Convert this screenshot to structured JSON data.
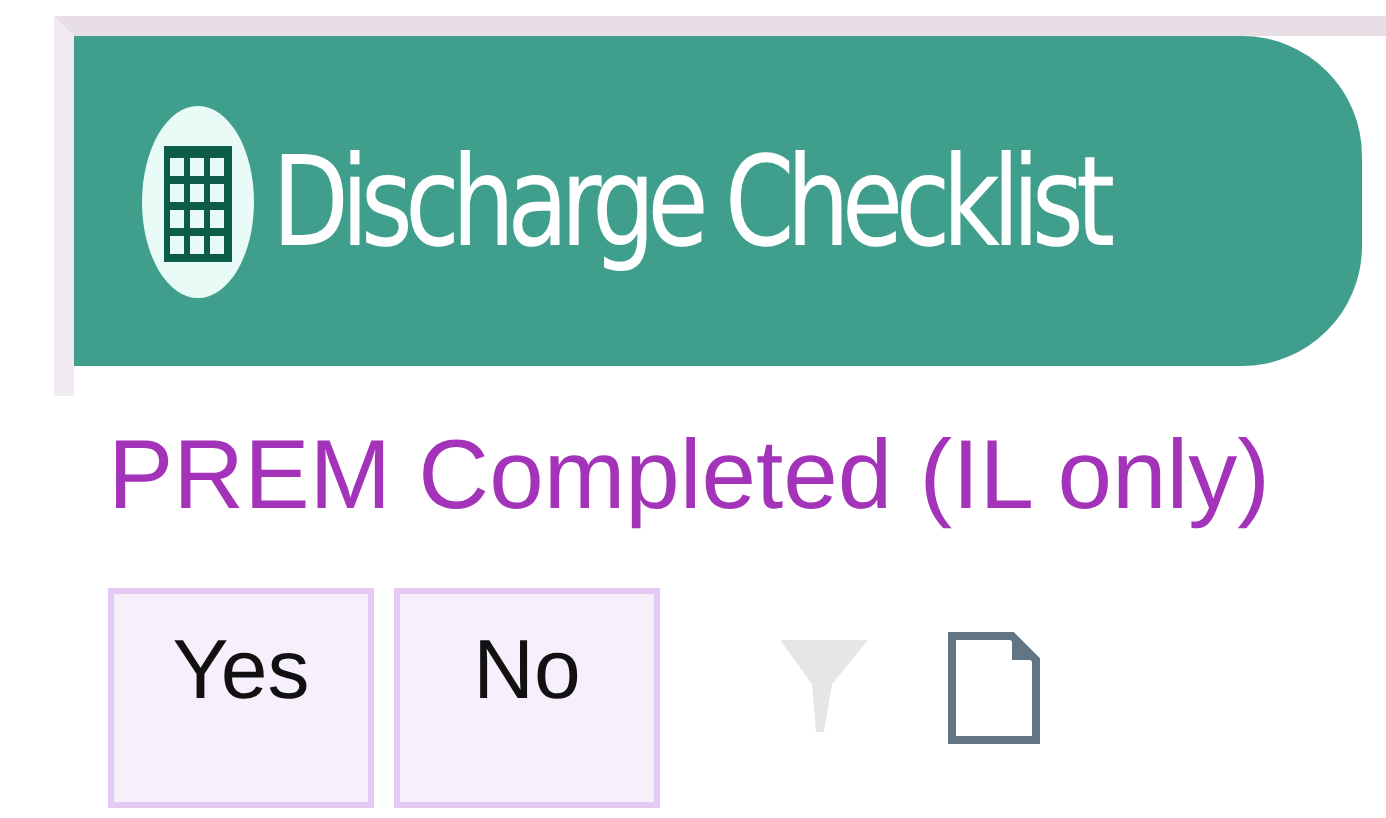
{
  "header": {
    "title": "Discharge Checklist"
  },
  "question": {
    "label": "PREM Completed (IL only)",
    "options": [
      {
        "label": "Yes"
      },
      {
        "label": "No"
      }
    ]
  }
}
